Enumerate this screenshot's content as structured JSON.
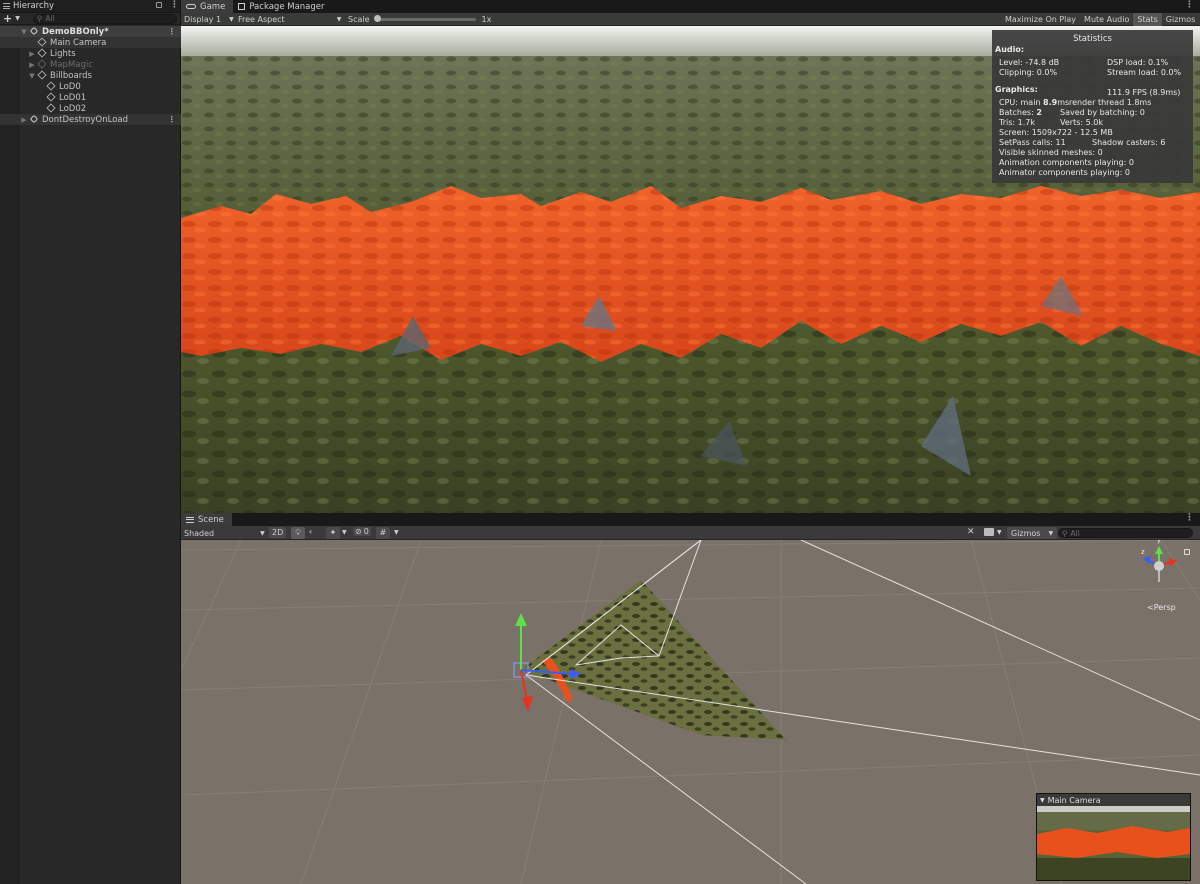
{
  "hierarchy": {
    "tab_label": "Hierarchy",
    "search_placeholder": "All",
    "items": [
      {
        "label": "DemoBBOnly*",
        "bold": true
      },
      {
        "label": "Main Camera"
      },
      {
        "label": "Lights"
      },
      {
        "label": "MapMagic"
      },
      {
        "label": "Billboards"
      },
      {
        "label": "LoD0"
      },
      {
        "label": "LoD01"
      },
      {
        "label": "LoD02"
      },
      {
        "label": "DontDestroyOnLoad"
      }
    ]
  },
  "game": {
    "tabs": [
      {
        "label": "Game"
      },
      {
        "label": "Package Manager"
      }
    ],
    "toolbar": {
      "display": "Display 1",
      "aspect": "Free Aspect",
      "scale_label": "Scale",
      "scale_value": "1x",
      "maximize": "Maximize On Play",
      "mute": "Mute Audio",
      "stats": "Stats",
      "gizmos": "Gizmos"
    },
    "statistics": {
      "title": "Statistics",
      "audio_header": "Audio:",
      "level": "Level: -74.8 dB",
      "dsp": "DSP load: 0.1%",
      "clipping": "Clipping: 0.0%",
      "stream": "Stream load: 0.0%",
      "graphics_header": "Graphics:",
      "fps": "111.9 FPS (8.9ms)",
      "cpu_main_label": "CPU: main ",
      "cpu_main_value": "8.9",
      "cpu_main_unit": "ms",
      "render_thread": "render thread 1.8ms",
      "batches_label": "Batches: ",
      "batches_value": "2",
      "saved_batching": "Saved by batching: 0",
      "tris": "Tris: 1.7k",
      "verts": "Verts: 5.0k",
      "screen": "Screen: 1509x722 - 12.5 MB",
      "setpass": "SetPass calls: 11",
      "shadow": "Shadow casters: 6",
      "skinned": "Visible skinned meshes: 0",
      "animation": "Animation components playing: 0",
      "animator": "Animator components playing: 0"
    }
  },
  "scene": {
    "tab_label": "Scene",
    "toolbar": {
      "shading": "Shaded",
      "mode2d": "2D",
      "hidden_count": "0",
      "gizmos": "Gizmos",
      "search_placeholder": "All"
    },
    "persp_label": "Persp",
    "axis_y": "y",
    "axis_z": "z",
    "camera_preview_title": "Main Camera"
  },
  "colors": {
    "terrain_grass": "#5e6a3a",
    "terrain_orange": "#e8501c",
    "scene_ground": "#7a7168"
  }
}
